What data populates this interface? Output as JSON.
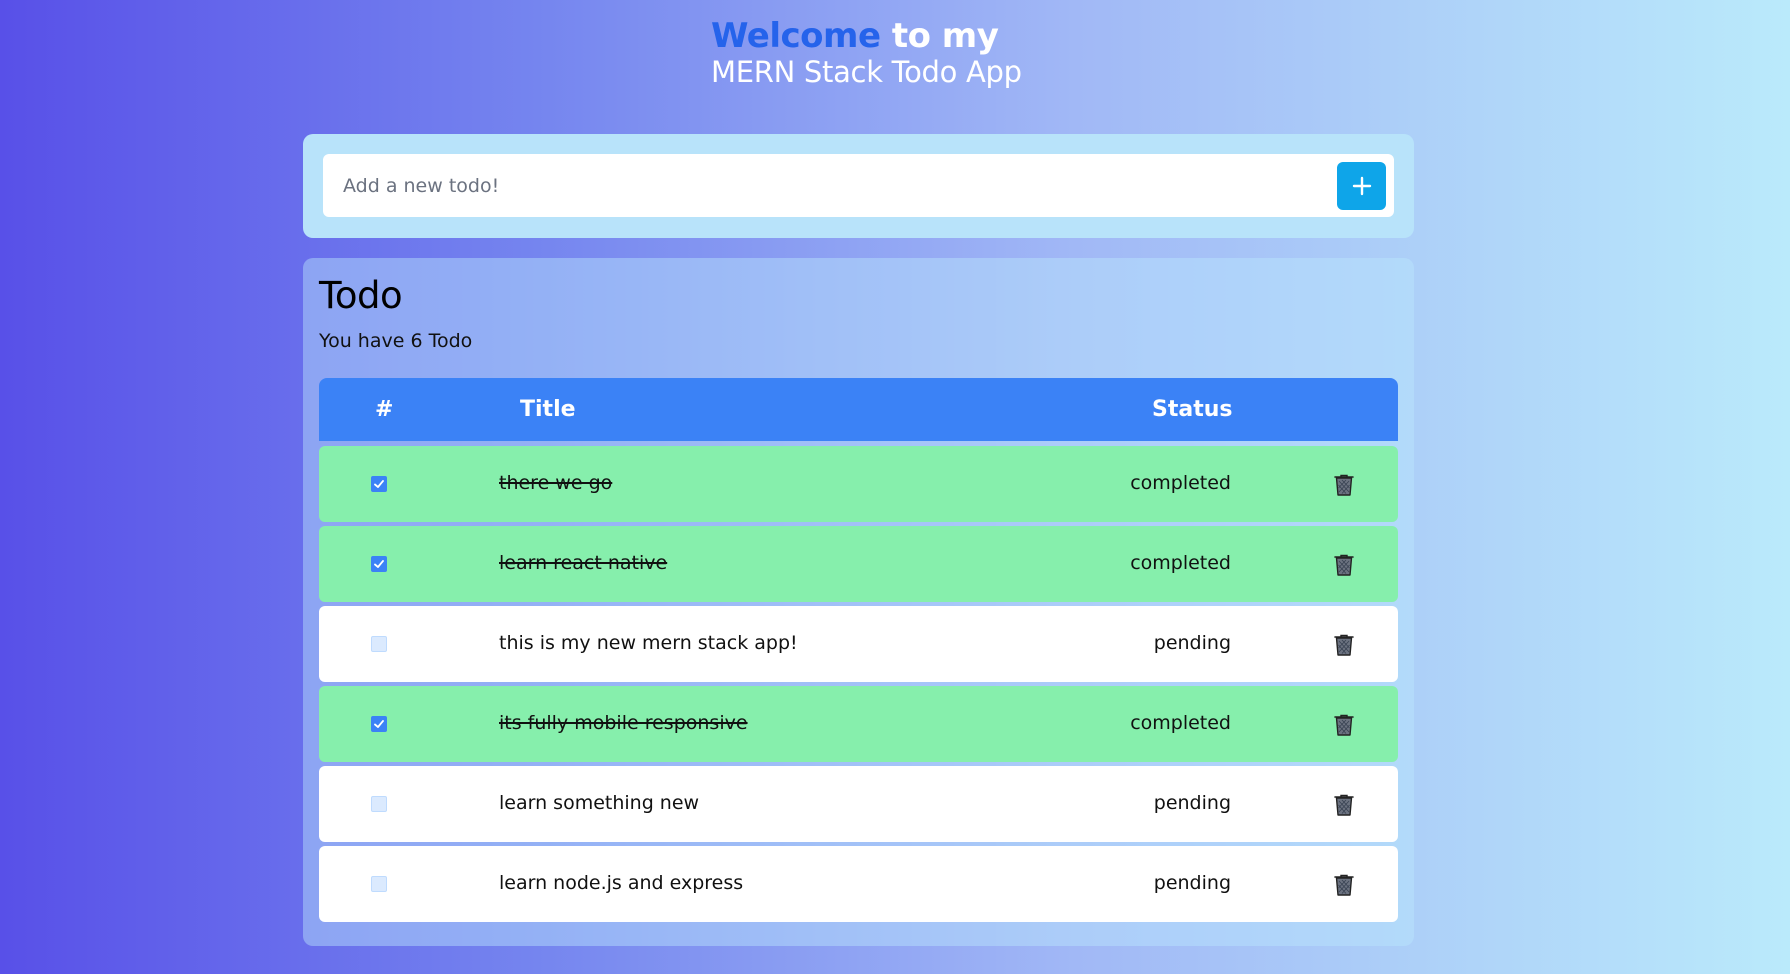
{
  "header": {
    "welcome": "Welcome",
    "to_my": "to my",
    "subtitle": "MERN Stack Todo App"
  },
  "add_todo": {
    "placeholder": "Add a new todo!",
    "button_icon": "plus-icon"
  },
  "todo_list": {
    "title": "Todo",
    "count_prefix": "You have",
    "count": "6",
    "count_suffix": "Todo",
    "columns": {
      "number": "#",
      "title": "Title",
      "status": "Status"
    },
    "items": [
      {
        "title": "there we go",
        "status": "completed",
        "checked": true
      },
      {
        "title": "learn react native",
        "status": "completed",
        "checked": true
      },
      {
        "title": "this is my new mern stack app!",
        "status": "pending",
        "checked": false
      },
      {
        "title": "its fully mobile responsive",
        "status": "completed",
        "checked": true
      },
      {
        "title": "learn something new",
        "status": "pending",
        "checked": false
      },
      {
        "title": "learn node.js and express",
        "status": "pending",
        "checked": false
      }
    ]
  },
  "colors": {
    "welcome_accent": "#2563eb",
    "table_header": "#3b82f6",
    "completed_row": "#86efac",
    "pending_row": "#ffffff",
    "add_button": "#0ea5e9"
  },
  "icons": {
    "delete": "trash-icon",
    "check": "check-icon"
  }
}
